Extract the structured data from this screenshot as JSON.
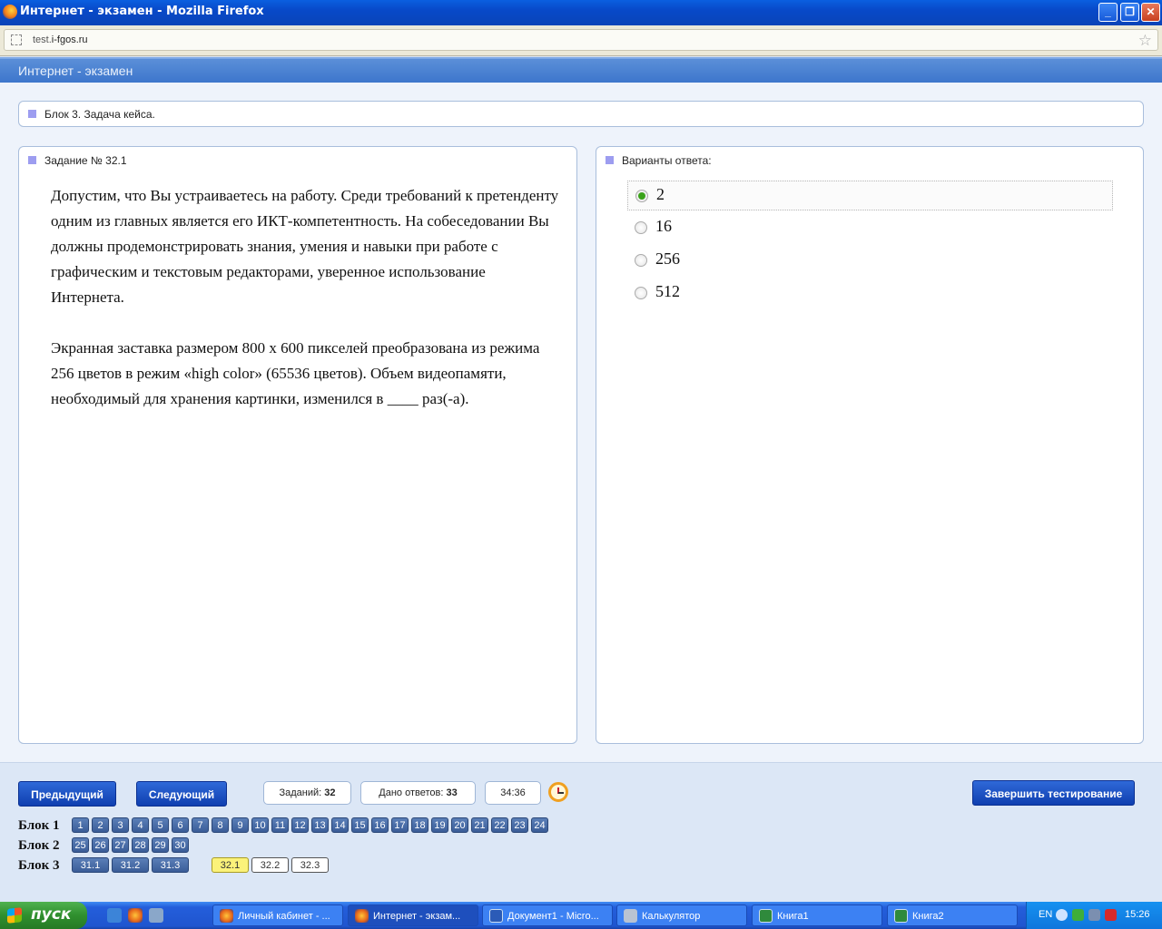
{
  "window": {
    "title": "Интернет - экзамен - Mozilla Firefox",
    "min_label": "_",
    "max_label": "❐",
    "close_label": "✕"
  },
  "browser": {
    "url_prefix": "test.",
    "url_domain": "i-fgos.ru"
  },
  "app": {
    "header_title": "Интернет - экзамен"
  },
  "block_title": "Блок 3. Задача кейса.",
  "task": {
    "label": "Задание № 32.1",
    "paragraph1": "Допустим, что Вы устраиваетесь на работу. Среди требований к претенденту одним из главных является его ИКТ-компетентность. На собеседовании Вы должны продемонстрировать знания, умения и навыки при работе с графическим и текстовым редакторами, уверенное использование Интернета.",
    "paragraph2": "Экранная заставка размером 800 х 600 пикселей преобразована из режима 256 цветов в режим «high color» (65536 цветов). Объем видеопамяти, необходимый для хранения картинки, изменился в ____ раз(-а)."
  },
  "answers": {
    "label": "Варианты ответа:",
    "options": [
      "2",
      "16",
      "256",
      "512"
    ],
    "selected": "2"
  },
  "footer": {
    "prev_label": "Предыдущий",
    "next_label": "Следующий",
    "tasks_label": "Заданий:",
    "tasks_value": "32",
    "answered_label": "Дано ответов:",
    "answered_value": "33",
    "timer": "34:36",
    "finish_label": "Завершить тестирование",
    "blocks": [
      {
        "label": "Блок 1",
        "items": [
          "1",
          "2",
          "3",
          "4",
          "5",
          "6",
          "7",
          "8",
          "9",
          "10",
          "11",
          "12",
          "13",
          "14",
          "15",
          "16",
          "17",
          "18",
          "19",
          "20",
          "21",
          "22",
          "23",
          "24"
        ]
      },
      {
        "label": "Блок 2",
        "items": [
          "25",
          "26",
          "27",
          "28",
          "29",
          "30"
        ]
      },
      {
        "label": "Блок 3",
        "items": [
          "31.1",
          "31.2",
          "31.3"
        ],
        "items2": [
          "32.1",
          "32.2",
          "32.3"
        ],
        "current": "32.1"
      }
    ]
  },
  "taskbar": {
    "start_label": "пуск",
    "items": [
      "Личный кабинет - ...",
      "Интернет - экзам...",
      "Документ1 - Micro...",
      "Калькулятор",
      "Книга1",
      "Книга2"
    ],
    "active": "Интернет - экзам...",
    "lang": "EN",
    "time": "15:26"
  }
}
